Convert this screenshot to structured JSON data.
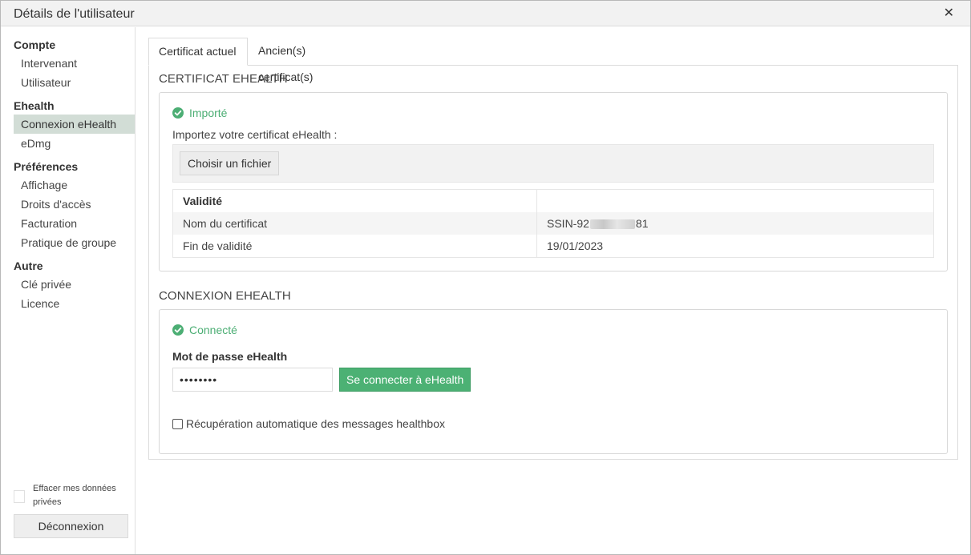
{
  "window": {
    "title": "Détails de l'utilisateur",
    "close_glyph": "✕"
  },
  "sidebar": {
    "groups": [
      {
        "label": "Compte",
        "items": [
          "Intervenant",
          "Utilisateur"
        ]
      },
      {
        "label": "Ehealth",
        "items": [
          "Connexion eHealth",
          "eDmg"
        ]
      },
      {
        "label": "Préférences",
        "items": [
          "Affichage",
          "Droits d'accès",
          "Facturation",
          "Pratique de groupe"
        ]
      },
      {
        "label": "Autre",
        "items": [
          "Clé privée",
          "Licence"
        ]
      }
    ],
    "active_item": "Connexion eHealth",
    "erase_label": "Effacer mes données privées",
    "erase_checked": false,
    "logout_label": "Déconnexion"
  },
  "tabs": [
    {
      "label": "Certificat actuel",
      "active": true
    },
    {
      "label": "Ancien(s) certificat(s)",
      "active": false
    }
  ],
  "certificate": {
    "section_title": "CERTIFICAT EHEALTH",
    "status": "Importé",
    "status_icon": "check-circle-icon",
    "import_label": "Importez votre certificat eHealth :",
    "file_button": "Choisir un fichier",
    "table": {
      "header": "Validité",
      "rows": [
        {
          "label": "Nom du certificat",
          "value_prefix": "SSIN-92",
          "value_suffix": "81"
        },
        {
          "label": "Fin de validité",
          "value": "19/01/2023"
        }
      ]
    }
  },
  "connection": {
    "section_title": "CONNEXION EHEALTH",
    "status": "Connecté",
    "status_icon": "check-circle-icon",
    "password_label": "Mot de passe eHealth",
    "password_value": "••••••••",
    "connect_button": "Se connecter à eHealth",
    "auto_fetch_label": "Récupération automatique des messages healthbox",
    "auto_fetch_checked": false
  },
  "colors": {
    "accent_green": "#4cb174",
    "status_green": "#4cae74",
    "active_nav_bg": "#d2ddd6"
  }
}
